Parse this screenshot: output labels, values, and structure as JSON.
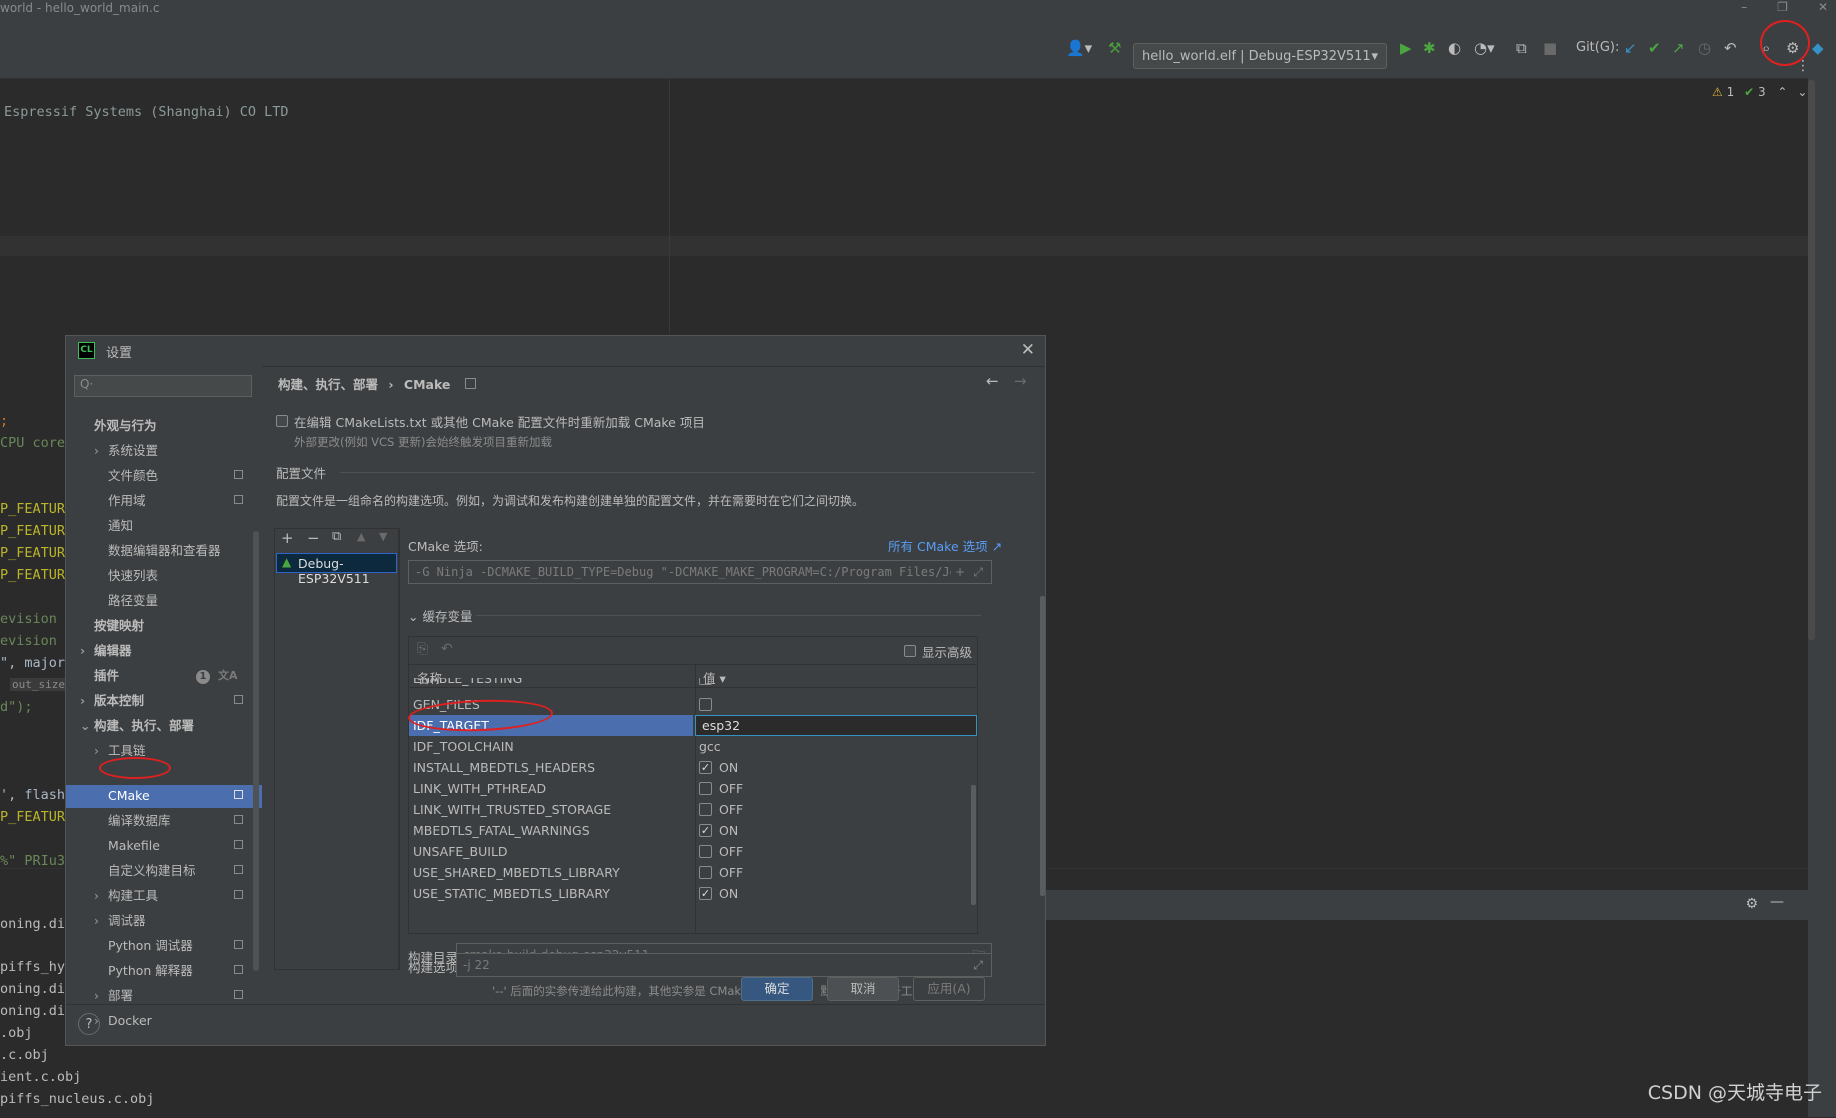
{
  "window": {
    "title": "world - hello_world_main.c"
  },
  "toolbar": {
    "run_config": "hello_world.elf | Debug-ESP32V511",
    "git_label": "Git(G):"
  },
  "editor": {
    "inspections": {
      "warnings": "1",
      "checks": "3"
    },
    "lines": [
      "Espressif Systems (Shanghai) CO LTD",
      ";",
      "CPU core(",
      "P_FEATURE",
      "P_FEATURE",
      "P_FEATURE",
      "P_FEATURE",
      "evision /",
      "evision %",
      "\", major",
      "out_size:",
      "d\");",
      "', flash_",
      "P_FEATURE",
      "%\" PRIu32"
    ]
  },
  "bottom_panel": {
    "lines": [
      "oning.di",
      "piffs_hy",
      "oning.di",
      "oning.di",
      ".obj",
      ".c.obj",
      "ient.c.obj",
      "piffs_nucleus.c.obj"
    ]
  },
  "dialog": {
    "title": "设置",
    "icon_text": "CL",
    "search_placeholder": "Q·",
    "tree": {
      "appearance": "外观与行为",
      "system_settings": "系统设置",
      "file_colors": "文件颜色",
      "scopes": "作用域",
      "notifications": "通知",
      "data_editors": "数据编辑器和查看器",
      "quick_lists": "快速列表",
      "path_variables": "路径变量",
      "keymap": "按键映射",
      "editor": "编辑器",
      "plugins": "插件",
      "plugins_badge": "1",
      "version_control": "版本控制",
      "build_exec_deploy": "构建、执行、部署",
      "toolchains": "工具链",
      "cmake": "CMake",
      "compilation_db": "编译数据库",
      "makefile": "Makefile",
      "custom_build_targets": "自定义构建目标",
      "build_tools": "构建工具",
      "debugger": "调试器",
      "python_debugger": "Python 调试器",
      "python_interpreter": "Python 解释器",
      "deployment": "部署",
      "docker": "Docker"
    },
    "breadcrumb": {
      "parent": "构建、执行、部署",
      "sep": "›",
      "current": "CMake"
    },
    "reload_option": "在编辑 CMakeLists.txt 或其他 CMake 配置文件时重新加载 CMake 项目",
    "reload_hint": "外部更改(例如 VCS 更新)会始终触发项目重新加载",
    "profiles_section": "配置文件",
    "profiles_desc": "配置文件是一组命名的构建选项。例如，为调试和发布构建创建单独的配置文件，并在需要时在它们之间切换。",
    "profiles": [
      "Debug-ESP32V511"
    ],
    "cmake_options_label": "CMake 选项:",
    "all_cmake_options_link": "所有 CMake 选项 ↗",
    "cmake_options_value": "-G Ninja -DCMAKE_BUILD_TYPE=Debug \"-DCMAKE_MAKE_PROGRAM=C:/Program Files/Jet",
    "cache_section": "缓存变量",
    "show_advanced": "显示高级",
    "table": {
      "col_name": "名称",
      "col_value": "值 ▾",
      "rows": [
        {
          "name": "ENABLE_TESTING",
          "value": ""
        },
        {
          "name": "GEN_FILES",
          "value": ""
        },
        {
          "name": "IDF_TARGET",
          "value": "esp32"
        },
        {
          "name": "IDF_TOOLCHAIN",
          "value": "gcc"
        },
        {
          "name": "INSTALL_MBEDTLS_HEADERS",
          "value": "ON"
        },
        {
          "name": "LINK_WITH_PTHREAD",
          "value": "OFF"
        },
        {
          "name": "LINK_WITH_TRUSTED_STORAGE",
          "value": "OFF"
        },
        {
          "name": "MBEDTLS_FATAL_WARNINGS",
          "value": "ON"
        },
        {
          "name": "UNSAFE_BUILD",
          "value": "OFF"
        },
        {
          "name": "USE_SHARED_MBEDTLS_LIBRARY",
          "value": "OFF"
        },
        {
          "name": "USE_STATIC_MBEDTLS_LIBRARY",
          "value": "ON"
        }
      ]
    },
    "build_dir_label": "构建目录:",
    "build_dir_value": "cmake-build-debug-esp32v511",
    "build_opts_label": "构建选项:",
    "build_opts_value": "-j 22",
    "build_opts_hint": "'--' 后面的实参传递给此构建，其他实参是 CMake 命令行形参。默认选项取决于工具链的环境。",
    "buttons": {
      "ok": "确定",
      "cancel": "取消",
      "apply": "应用(A)"
    },
    "help": "?"
  },
  "watermark": "CSDN @天城寺电子",
  "colors": {
    "accent": "#4b6eaf",
    "annotation": "#e02020",
    "primary_button": "#365880"
  }
}
